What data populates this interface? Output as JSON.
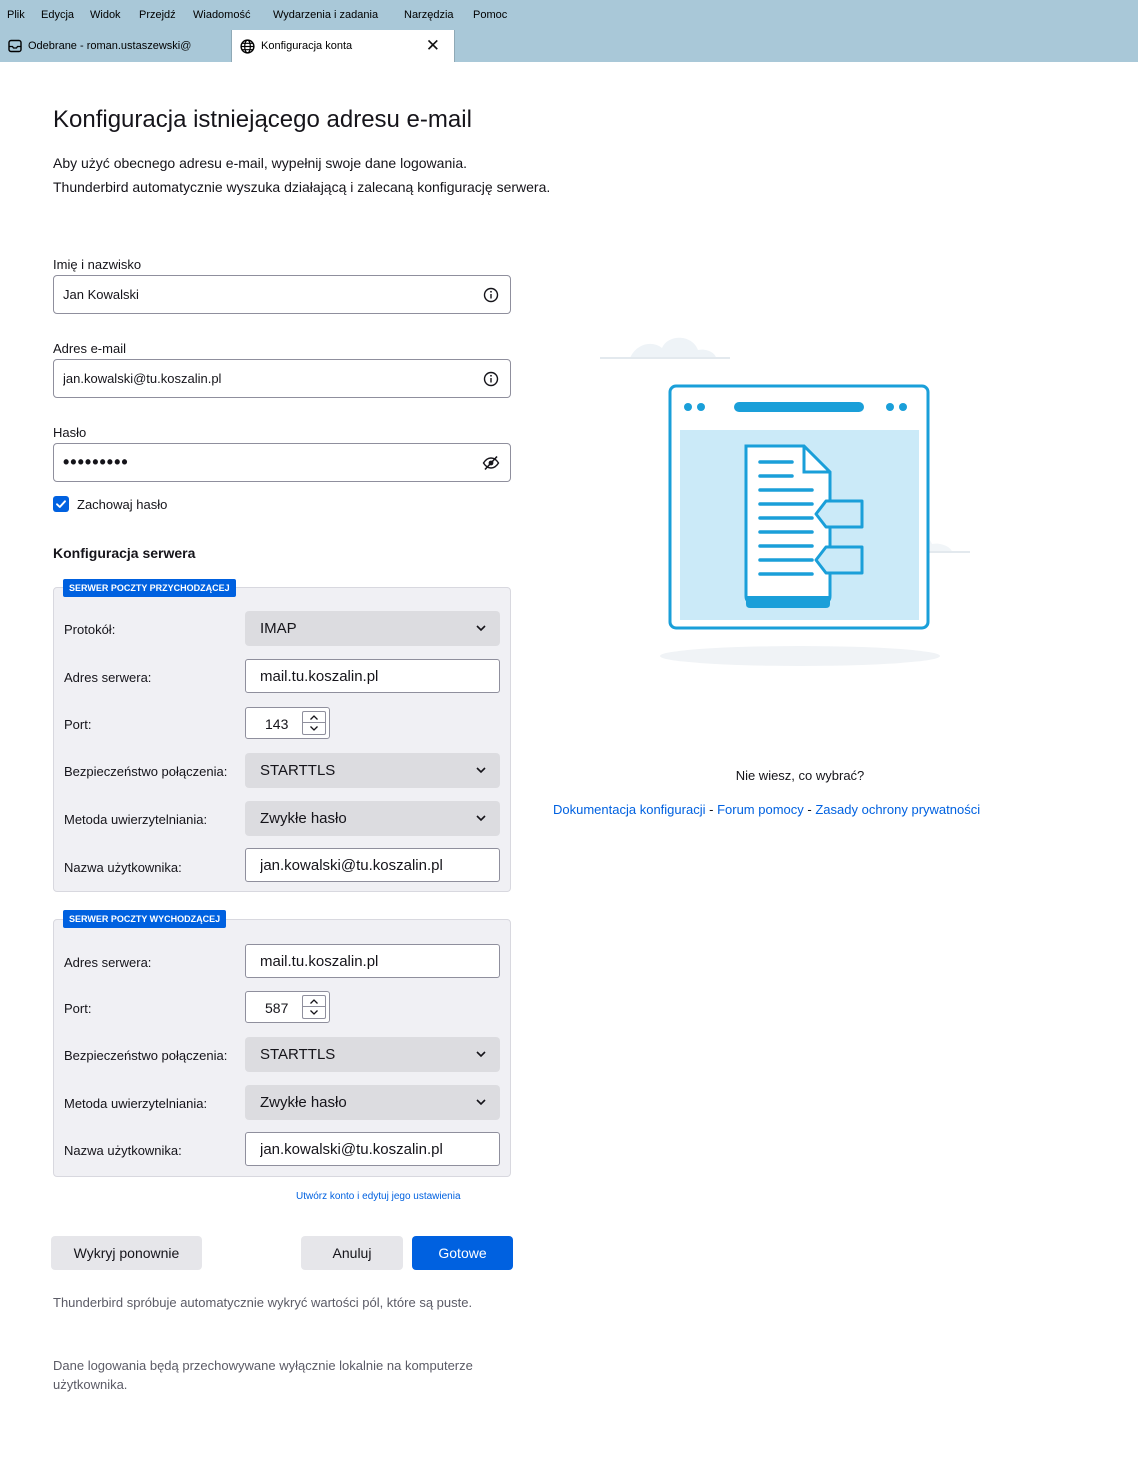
{
  "menu": [
    "Plik",
    "Edycja",
    "Widok",
    "Przejdź",
    "Wiadomość",
    "Wydarzenia i zadania",
    "Narzędzia",
    "Pomoc"
  ],
  "tabs": {
    "inbox": "Odebrane - roman.ustaszewski@",
    "account_setup": "Konfiguracja konta",
    "close_glyph": "✕"
  },
  "page": {
    "title": "Konfiguracja istniejącego adresu e-mail",
    "intro_line1": "Aby użyć obecnego adresu e-mail, wypełnij swoje dane logowania.",
    "intro_line2": "Thunderbird automatycznie wyszuka działającą i zalecaną konfigurację serwera."
  },
  "form": {
    "name_label": "Imię i nazwisko",
    "name_value": "Jan Kowalski",
    "email_label": "Adres e-mail",
    "email_value": "jan.kowalski@tu.koszalin.pl",
    "password_label": "Hasło",
    "password_value": "•••••••••",
    "remember_label": "Zachowaj hasło",
    "remember_checked": true
  },
  "server": {
    "heading": "Konfiguracja serwera",
    "incoming": {
      "legend": "SERWER POCZTY PRZYCHODZĄCEJ",
      "protocol_label": "Protokół:",
      "protocol_value": "IMAP",
      "address_label": "Adres serwera:",
      "address_value": "mail.tu.koszalin.pl",
      "port_label": "Port:",
      "port_value": "143",
      "security_label": "Bezpieczeństwo połączenia:",
      "security_value": "STARTTLS",
      "auth_label": "Metoda uwierzytelniania:",
      "auth_value": "Zwykłe hasło",
      "username_label": "Nazwa użytkownika:",
      "username_value": "jan.kowalski@tu.koszalin.pl"
    },
    "outgoing": {
      "legend": "SERWER POCZTY WYCHODZĄCEJ",
      "address_label": "Adres serwera:",
      "address_value": "mail.tu.koszalin.pl",
      "port_label": "Port:",
      "port_value": "587",
      "security_label": "Bezpieczeństwo połączenia:",
      "security_value": "STARTTLS",
      "auth_label": "Metoda uwierzytelniania:",
      "auth_value": "Zwykłe hasło",
      "username_label": "Nazwa użytkownika:",
      "username_value": "jan.kowalski@tu.koszalin.pl"
    },
    "advanced_link": "Utwórz konto i edytuj jego ustawienia"
  },
  "buttons": {
    "retest": "Wykryj ponownie",
    "cancel": "Anuluj",
    "done": "Gotowe"
  },
  "notes": {
    "autodetect": "Thunderbird spróbuje automatycznie wykryć wartości pól, które są puste.",
    "local_storage": "Dane logowania będą przechowywane wyłącznie lokalnie na komputerze użytkownika."
  },
  "help": {
    "question": "Nie wiesz, co wybrać?",
    "docs_link": "Dokumentacja konfiguracji",
    "forum_link": "Forum pomocy",
    "privacy_link": "Zasady ochrony prywatności",
    "separator": "-"
  },
  "colors": {
    "accent": "#0061e0",
    "chrome": "#a9c8d8",
    "fieldset_bg": "#f0f0f4",
    "illustration_stroke": "#1a9fd9"
  },
  "icons": {
    "info": "info-icon",
    "eye_off": "eye-slash-icon",
    "chevron": "chevron-down-icon",
    "inbox": "inbox-icon",
    "globe": "globe-icon"
  }
}
